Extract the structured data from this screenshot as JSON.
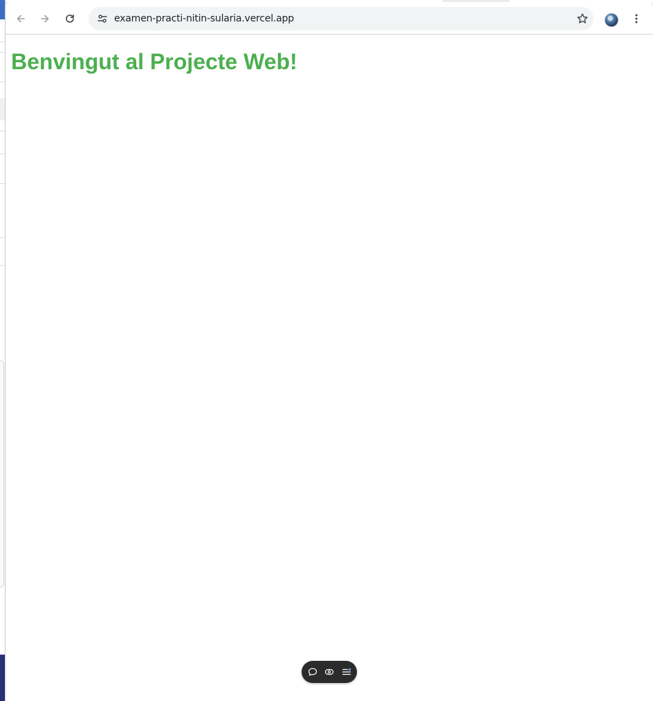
{
  "browser": {
    "nav": {
      "back_icon": "arrow-left-icon",
      "forward_icon": "arrow-right-icon",
      "reload_icon": "reload-icon"
    },
    "omnibox": {
      "site_info_icon": "tune-icon",
      "url": "examen-practi-nitin-sularia.vercel.app",
      "bookmark_icon": "star-outline-icon"
    },
    "profile_icon": "avatar",
    "menu_icon": "kebab-menu-icon"
  },
  "page": {
    "heading": "Benvingut al Projecte Web!",
    "heading_color": "#4caf50"
  },
  "floating_toolbar": {
    "icons": [
      "comment-icon",
      "eye-toggle-icon",
      "list-settings-icon"
    ]
  }
}
